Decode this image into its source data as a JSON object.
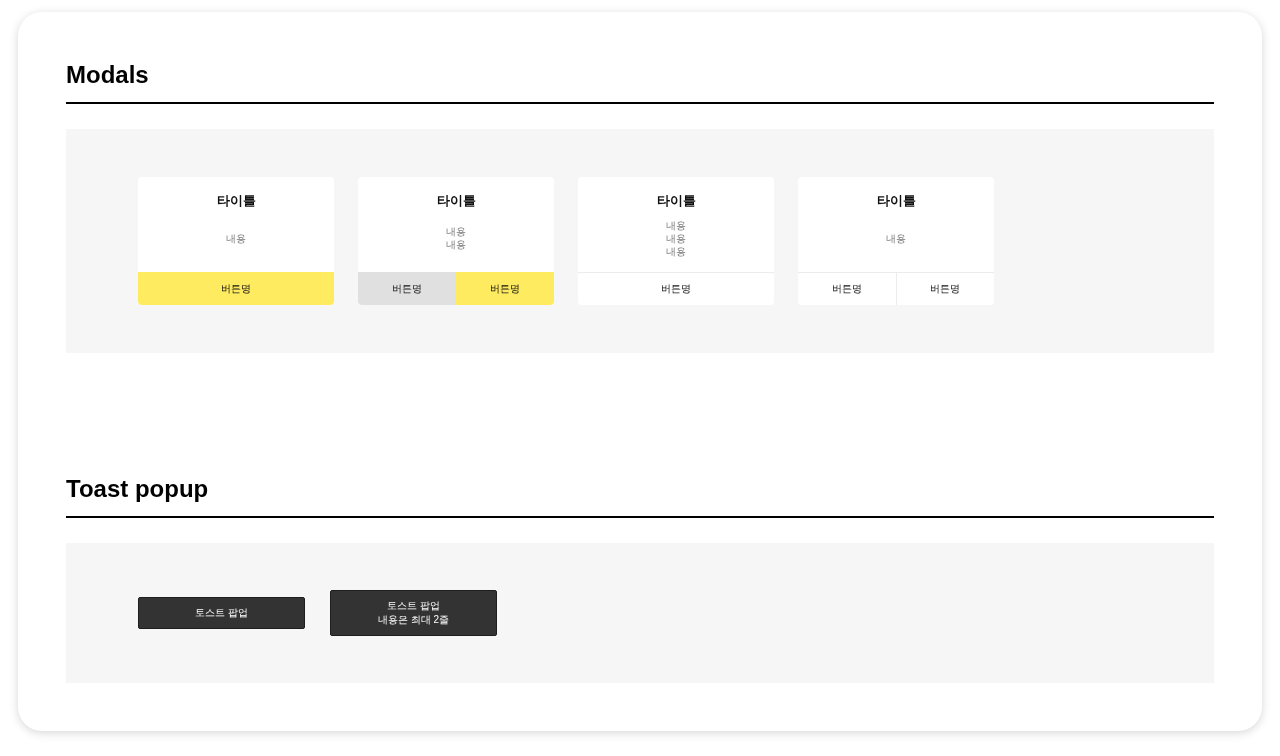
{
  "sections": [
    {
      "kind": "modals",
      "title": "Modals",
      "modals": [
        {
          "title": "타이틀",
          "content_lines": [
            "내용"
          ],
          "buttons": [
            {
              "label": "버튼명",
              "kind": "primary"
            }
          ]
        },
        {
          "title": "타이틀",
          "content_lines": [
            "내용",
            "내용"
          ],
          "buttons": [
            {
              "label": "버튼명",
              "kind": "secondary"
            },
            {
              "label": "버튼명",
              "kind": "primary"
            }
          ]
        },
        {
          "title": "타이틀",
          "content_lines": [
            "내용",
            "내용",
            "내용"
          ],
          "buttons": [
            {
              "label": "버튼명",
              "kind": "plain"
            }
          ]
        },
        {
          "title": "타이틀",
          "content_lines": [
            "내용"
          ],
          "buttons": [
            {
              "label": "버튼명",
              "kind": "plain"
            },
            {
              "label": "버튼명",
              "kind": "plain"
            }
          ]
        }
      ]
    },
    {
      "kind": "toasts",
      "title": "Toast popup",
      "toasts": [
        {
          "lines": [
            "토스트 팝업"
          ]
        },
        {
          "lines": [
            "토스트 팝업",
            "내용은 최대 2줄"
          ]
        }
      ]
    }
  ]
}
